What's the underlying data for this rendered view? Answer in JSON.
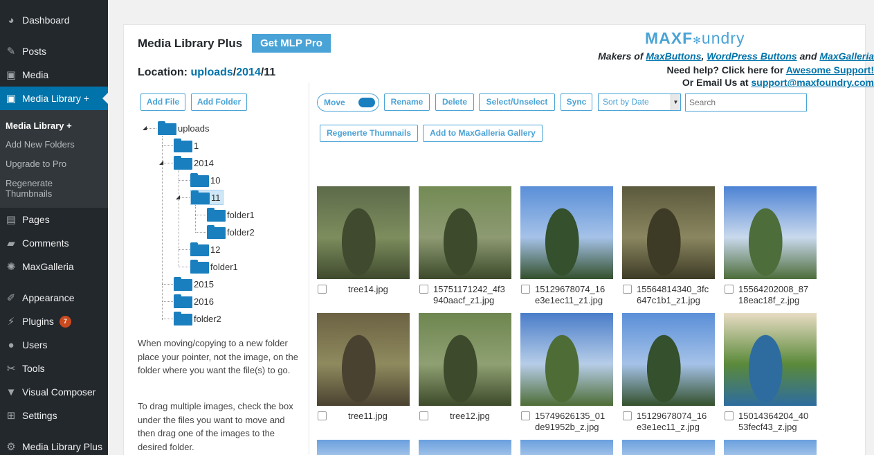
{
  "sidebar": {
    "items": [
      {
        "label": "Dashboard",
        "icon": "dashboard-icon",
        "glyph": "◕"
      },
      {
        "label": "Posts",
        "icon": "pin-icon",
        "glyph": "✎"
      },
      {
        "label": "Media",
        "icon": "media-icon",
        "glyph": "▣"
      },
      {
        "label": "Media Library +",
        "icon": "media-library-icon",
        "glyph": "▣"
      },
      {
        "label": "Pages",
        "icon": "pages-icon",
        "glyph": "▤"
      },
      {
        "label": "Comments",
        "icon": "comments-icon",
        "glyph": "▰"
      },
      {
        "label": "MaxGalleria",
        "icon": "maxgalleria-icon",
        "glyph": "✺"
      },
      {
        "label": "Appearance",
        "icon": "appearance-icon",
        "glyph": "✐"
      },
      {
        "label": "Plugins",
        "icon": "plugins-icon",
        "glyph": "⚡",
        "badge": "7"
      },
      {
        "label": "Users",
        "icon": "users-icon",
        "glyph": "●"
      },
      {
        "label": "Tools",
        "icon": "tools-icon",
        "glyph": "✂"
      },
      {
        "label": "Visual Composer",
        "icon": "visual-composer-icon",
        "glyph": "▼"
      },
      {
        "label": "Settings",
        "icon": "settings-icon",
        "glyph": "⊞"
      },
      {
        "label": "Media Library Plus",
        "icon": "gear-icon",
        "glyph": "⚙"
      }
    ],
    "submenu": [
      "Media Library +",
      "Add New Folders",
      "Upgrade to Pro",
      "Regenerate\nThumbnails"
    ]
  },
  "header": {
    "title": "Media Library Plus",
    "pro_button": "Get MLP Pro",
    "location_label": "Location:",
    "location_parts": [
      "uploads",
      "/",
      "2014",
      "/",
      "11"
    ]
  },
  "branding": {
    "logo_max": "MAXF",
    "logo_rest": "undry",
    "makers_prefix": "Makers of ",
    "maxbuttons": "MaxButtons",
    "comma": ", ",
    "wpbuttons": "WordPress Buttons",
    "and": " and ",
    "maxgalleria": "MaxGalleria",
    "need_help": "Need help? Click here for ",
    "support_link": "Awesome Support!",
    "email_prefix": "Or Email Us at ",
    "email": "support@maxfoundry.com"
  },
  "left_buttons": {
    "add_file": "Add File",
    "add_folder": "Add Folder"
  },
  "tree": [
    {
      "label": "uploads"
    },
    {
      "label": "1"
    },
    {
      "label": "2014"
    },
    {
      "label": "10"
    },
    {
      "label": "11"
    },
    {
      "label": "folder1"
    },
    {
      "label": "folder2"
    },
    {
      "label": "12"
    },
    {
      "label": "folder1"
    },
    {
      "label": "2015"
    },
    {
      "label": "2016"
    },
    {
      "label": "folder2"
    }
  ],
  "help_text": [
    "When moving/copying to a new folder place your pointer, not the image, on the folder where you want the file(s) to go.",
    "To drag multiple images, check the box under the files you want to move and then drag one of the images to the desired folder."
  ],
  "toolbar": {
    "move": "Move",
    "rename": "Rename",
    "delete": "Delete",
    "select_unselect": "Select/Unselect",
    "sync": "Sync",
    "sort": "Sort by Date",
    "search_placeholder": "Search",
    "regenerate": "Regenerte Thumnails",
    "add_gallery": "Add to MaxGalleria Gallery"
  },
  "images": [
    {
      "name": "tree14.jpg",
      "colors": [
        "#5d6b4a",
        "#3f4a2e",
        "#7d8d5d"
      ]
    },
    {
      "name": "15751171242_4f3\n940aacf_z1.jpg",
      "colors": [
        "#748b55",
        "#3d4a2b",
        "#8d9a72"
      ]
    },
    {
      "name": "15129678074_16\ne3e1ec11_z1.jpg",
      "colors": [
        "#5a8fd8",
        "#34502c",
        "#a5c2e8"
      ]
    },
    {
      "name": "15564814340_3fc\n647c1b1_z1.jpg",
      "colors": [
        "#5c5a3d",
        "#3d3b26",
        "#8a8660"
      ]
    },
    {
      "name": "15564202008_87\n18eac18f_z.jpg",
      "colors": [
        "#4d83d4",
        "#4d6d3a",
        "#c9d9ed"
      ]
    },
    {
      "name": "tree11.jpg",
      "colors": [
        "#6b6243",
        "#4a4230",
        "#8f8a5e"
      ]
    },
    {
      "name": "tree12.jpg",
      "colors": [
        "#6e8650",
        "#3d4a2b",
        "#8fa072"
      ]
    },
    {
      "name": "15749626135_01\nde91952b_z.jpg",
      "colors": [
        "#4a7dc9",
        "#4e6d36",
        "#b6cde8"
      ]
    },
    {
      "name": "15129678074_16\ne3e1ec11_z.jpg",
      "colors": [
        "#5a8fd8",
        "#34502c",
        "#a5c2e8"
      ]
    },
    {
      "name": "15014364204_40\n53fecf43_z.jpg",
      "colors": [
        "#e8dcc4",
        "#2e6ca0",
        "#5b8a3a"
      ]
    }
  ]
}
